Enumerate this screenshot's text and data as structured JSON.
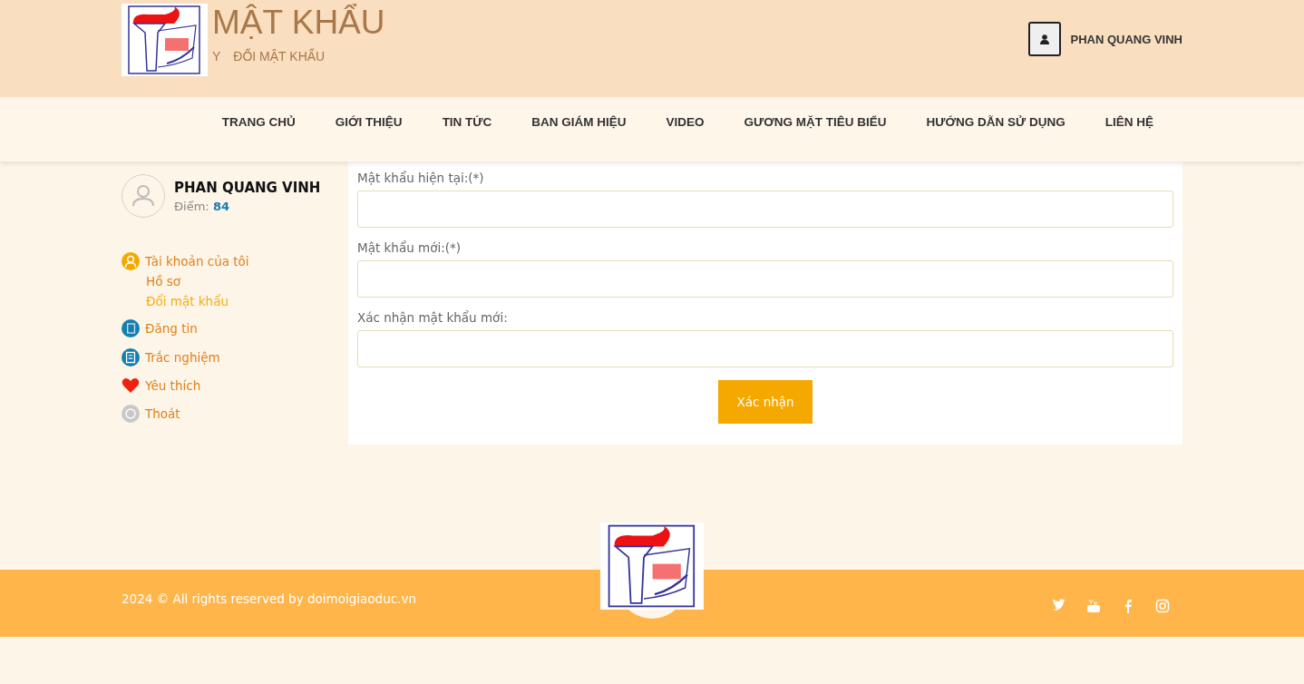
{
  "header": {
    "title": "MẬT KHẨU",
    "breadcrumb": [
      "Y",
      "ĐỔI MẬT KHẨU"
    ],
    "user_name": "PHAN QUANG VINH"
  },
  "nav": [
    {
      "label": "TRANG CHỦ"
    },
    {
      "label": "GIỚI THIỆU"
    },
    {
      "label": "TIN TỨC"
    },
    {
      "label": "BAN GIÁM HIỆU"
    },
    {
      "label": "VIDEO"
    },
    {
      "label": "GƯƠNG MẶT TIÊU BIỂU"
    },
    {
      "label": "HƯỚNG DẪN SỬ DỤNG"
    },
    {
      "label": "LIÊN HỆ"
    }
  ],
  "profile": {
    "name": "PHAN QUANG VINH",
    "points_label": "Điểm:",
    "points": "84"
  },
  "sidebar": {
    "items": [
      {
        "label": "Tài khoản của tôi",
        "kind": "account",
        "selected": false,
        "children": [
          {
            "label": "Hồ sơ",
            "selected": false
          },
          {
            "label": "Đổi mật khẩu",
            "selected": true
          }
        ]
      },
      {
        "label": "Đăng tin",
        "kind": "post",
        "selected": false
      },
      {
        "label": "Trắc nghiệm",
        "kind": "quiz",
        "selected": false
      },
      {
        "label": "Yêu thích",
        "kind": "favorite",
        "selected": false
      },
      {
        "label": "Thoát",
        "kind": "logout",
        "selected": false
      }
    ]
  },
  "form": {
    "fields": [
      {
        "label": "Mật khẩu hiện tại:(*)"
      },
      {
        "label": "Mật khẩu mới:(*)"
      },
      {
        "label": "Xác nhận mật khẩu mới:"
      }
    ],
    "submit": "Xác nhận"
  },
  "footer": {
    "copyright": "2024 ©  All rights reserved by doimoigiaoduc.vn",
    "social": [
      {
        "kind": "twitter"
      },
      {
        "kind": "youtube"
      },
      {
        "kind": "facebook"
      },
      {
        "kind": "instagram"
      }
    ]
  }
}
